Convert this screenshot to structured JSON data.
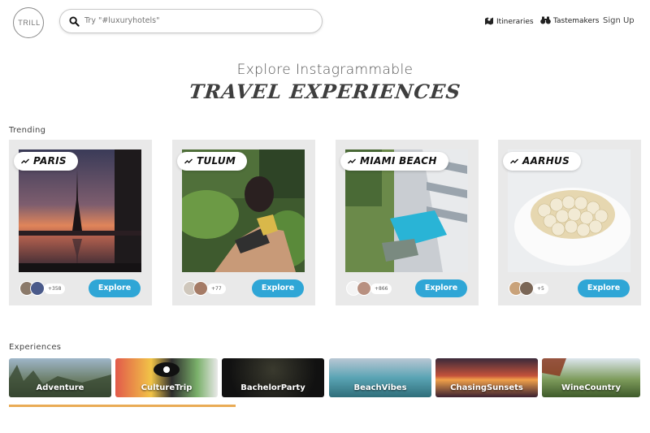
{
  "header": {
    "logo_text": "TRILL",
    "search_placeholder": "Try \"#luxuryhotels\"",
    "nav": [
      {
        "label": "Itineraries",
        "icon": "map-icon"
      },
      {
        "label": "Tastemakers",
        "icon": "binoculars-icon"
      },
      {
        "label": "Sign Up"
      }
    ]
  },
  "hero": {
    "line1": "Explore Instagrammable",
    "line2": "TRAVEL EXPERIENCES"
  },
  "trending": {
    "label": "Trending",
    "cards": [
      {
        "city": "PARIS",
        "count": "+358",
        "button": "Explore"
      },
      {
        "city": "TULUM",
        "count": "+77",
        "button": "Explore"
      },
      {
        "city": "MIAMI BEACH",
        "count": "+866",
        "button": "Explore"
      },
      {
        "city": "AARHUS",
        "count": "+5",
        "button": "Explore"
      }
    ]
  },
  "experiences": {
    "label": "Experiences",
    "items": [
      "Adventure",
      "CultureTrip",
      "BachelorParty",
      "BeachVibes",
      "ChasingSunsets",
      "WineCountry"
    ],
    "scroll_progress": 0.36
  },
  "colors": {
    "accent_blue": "#2fa6d6",
    "progress_orange": "#e9ab55",
    "card_bg": "#e9e9e9"
  }
}
